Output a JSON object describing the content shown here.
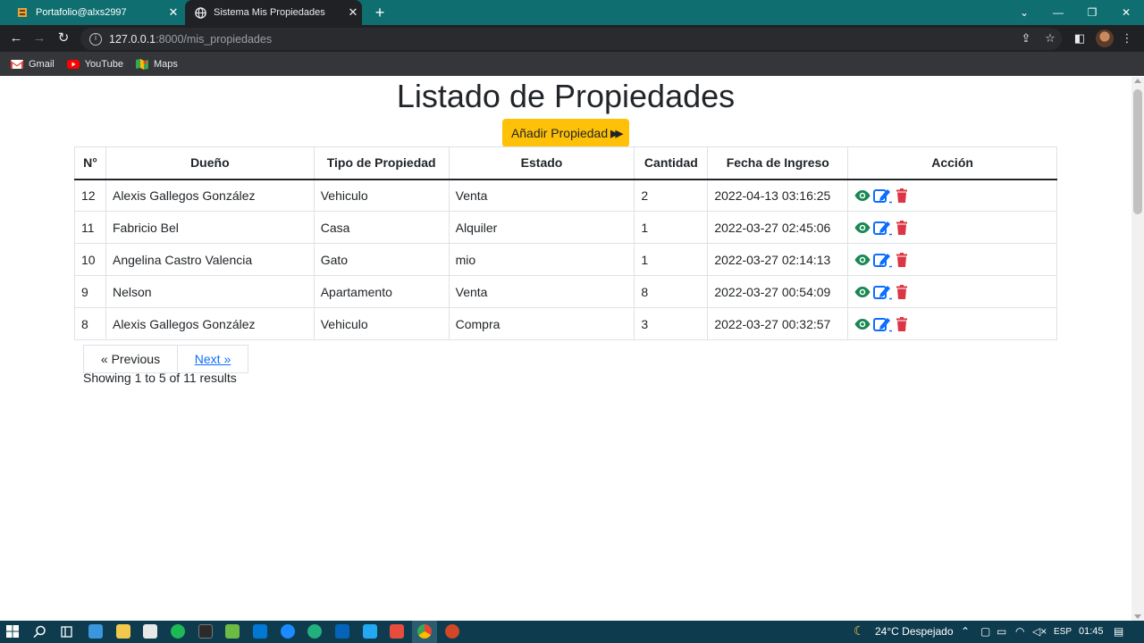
{
  "browser": {
    "tabs": [
      {
        "title": "Portafolio@alxs2997",
        "active": false
      },
      {
        "title": "Sistema Mis Propiedades",
        "active": true
      }
    ],
    "url_host": "127.0.0.1",
    "url_rest": ":8000/mis_propiedades",
    "bookmarks": [
      {
        "label": "Gmail",
        "color": "#ea4335"
      },
      {
        "label": "YouTube",
        "color": "#ff0000"
      },
      {
        "label": "Maps",
        "color": "#34a853"
      }
    ]
  },
  "page": {
    "title": "Listado de Propiedades",
    "add_button": "Añadir Propiedad",
    "columns": [
      "N°",
      "Dueño",
      "Tipo de Propiedad",
      "Estado",
      "Cantidad",
      "Fecha de Ingreso",
      "Acción"
    ],
    "rows": [
      {
        "n": "12",
        "owner": "Alexis Gallegos González",
        "type": "Vehiculo",
        "state": "Venta",
        "qty": "2",
        "date": "2022-04-13 03:16:25"
      },
      {
        "n": "11",
        "owner": "Fabricio Bel",
        "type": "Casa",
        "state": "Alquiler",
        "qty": "1",
        "date": "2022-03-27 02:45:06"
      },
      {
        "n": "10",
        "owner": "Angelina Castro Valencia",
        "type": "Gato",
        "state": "mio",
        "qty": "1",
        "date": "2022-03-27 02:14:13"
      },
      {
        "n": "9",
        "owner": "Nelson",
        "type": "Apartamento",
        "state": "Venta",
        "qty": "8",
        "date": "2022-03-27 00:54:09"
      },
      {
        "n": "8",
        "owner": "Alexis Gallegos González",
        "type": "Vehiculo",
        "state": "Compra",
        "qty": "3",
        "date": "2022-03-27 00:32:57"
      }
    ],
    "pagination": {
      "previous": "« Previous",
      "next": "Next »",
      "summary": "Showing 1 to 5 of 11 results"
    },
    "colors": {
      "view": "#198754",
      "edit": "#0d6efd",
      "delete": "#dc3545",
      "add_button": "#ffc107"
    }
  },
  "taskbar": {
    "weather": "24°C  Despejado",
    "lang": "ESP",
    "time": "01:45"
  }
}
